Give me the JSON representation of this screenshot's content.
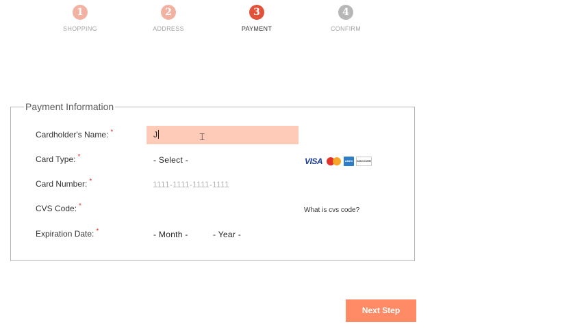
{
  "steps": [
    {
      "num": "1",
      "label": "SHOPPING",
      "state": "done"
    },
    {
      "num": "2",
      "label": "ADDRESS",
      "state": "done"
    },
    {
      "num": "3",
      "label": "PAYMENT",
      "state": "active"
    },
    {
      "num": "4",
      "label": "CONFIRM",
      "state": "todo"
    }
  ],
  "colors": {
    "active_step": "#e2513a",
    "done_step": "#f1b2a2",
    "todo_step": "#b7b7b7",
    "input_highlight": "#fecbb8",
    "button": "#ff8b66"
  },
  "form": {
    "legend": "Payment Information",
    "required_mark": "*",
    "name_label": "Cardholder's Name:",
    "name_value": "J",
    "type_label": "Card Type:",
    "type_value": "- Select -",
    "number_label": "Card Number:",
    "number_placeholder": "1111-1111-1111-1111",
    "cvs_label": "CVS Code:",
    "cvs_help": "What is cvs code?",
    "expiry_label": "Expiration Date:",
    "month_value": "- Month -",
    "year_value": "- Year -",
    "card_logos": {
      "visa": "VISA",
      "mastercard": "mastercard-logo",
      "amex": "AMEX",
      "discover": "DISCOVER"
    }
  },
  "next_button": "Next Step"
}
